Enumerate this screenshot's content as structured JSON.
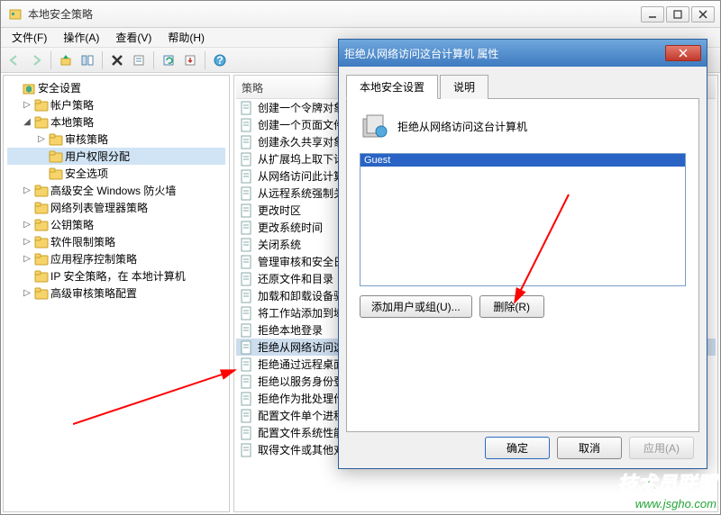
{
  "window": {
    "title": "本地安全策略"
  },
  "menu": {
    "file": "文件(F)",
    "action": "操作(A)",
    "view": "查看(V)",
    "help": "帮助(H)"
  },
  "tree": {
    "root": "安全设置",
    "items": [
      {
        "label": "帐户策略",
        "indent": 1,
        "expand": "▷"
      },
      {
        "label": "本地策略",
        "indent": 1,
        "expand": "◢"
      },
      {
        "label": "审核策略",
        "indent": 2,
        "expand": "▷"
      },
      {
        "label": "用户权限分配",
        "indent": 2,
        "expand": "",
        "selected": true
      },
      {
        "label": "安全选项",
        "indent": 2,
        "expand": ""
      },
      {
        "label": "高级安全 Windows 防火墙",
        "indent": 1,
        "expand": "▷"
      },
      {
        "label": "网络列表管理器策略",
        "indent": 1,
        "expand": ""
      },
      {
        "label": "公钥策略",
        "indent": 1,
        "expand": "▷"
      },
      {
        "label": "软件限制策略",
        "indent": 1,
        "expand": "▷"
      },
      {
        "label": "应用程序控制策略",
        "indent": 1,
        "expand": "▷"
      },
      {
        "label": "IP 安全策略，在 本地计算机",
        "indent": 1,
        "expand": ""
      },
      {
        "label": "高级审核策略配置",
        "indent": 1,
        "expand": "▷"
      }
    ]
  },
  "list": {
    "header": "策略",
    "items": [
      "创建一个令牌对象",
      "创建一个页面文件",
      "创建永久共享对象",
      "从扩展坞上取下计算机",
      "从网络访问此计算机",
      "从远程系统强制关机",
      "更改时区",
      "更改系统时间",
      "关闭系统",
      "管理审核和安全日志",
      "还原文件和目录",
      "加载和卸载设备驱动",
      "将工作站添加到域",
      "拒绝本地登录",
      "拒绝从网络访问这台计算机",
      "拒绝通过远程桌面服务登录",
      "拒绝以服务身份登录",
      "拒绝作为批处理作业登录",
      "配置文件单个进程",
      "配置文件系统性能",
      "取得文件或其他对象的所有权"
    ],
    "selected_index": 14
  },
  "dialog": {
    "title": "拒绝从网络访问这台计算机 属性",
    "tabs": {
      "t1": "本地安全设置",
      "t2": "说明"
    },
    "heading": "拒绝从网络访问这台计算机",
    "list_items": [
      "Guest"
    ],
    "selected_list_index": 0,
    "add_btn": "添加用户或组(U)...",
    "del_btn": "删除(R)",
    "ok": "确定",
    "cancel": "取消",
    "apply": "应用(A)"
  },
  "watermark": {
    "line1": "技术员联盟",
    "line2": "www.jsgho.com"
  }
}
